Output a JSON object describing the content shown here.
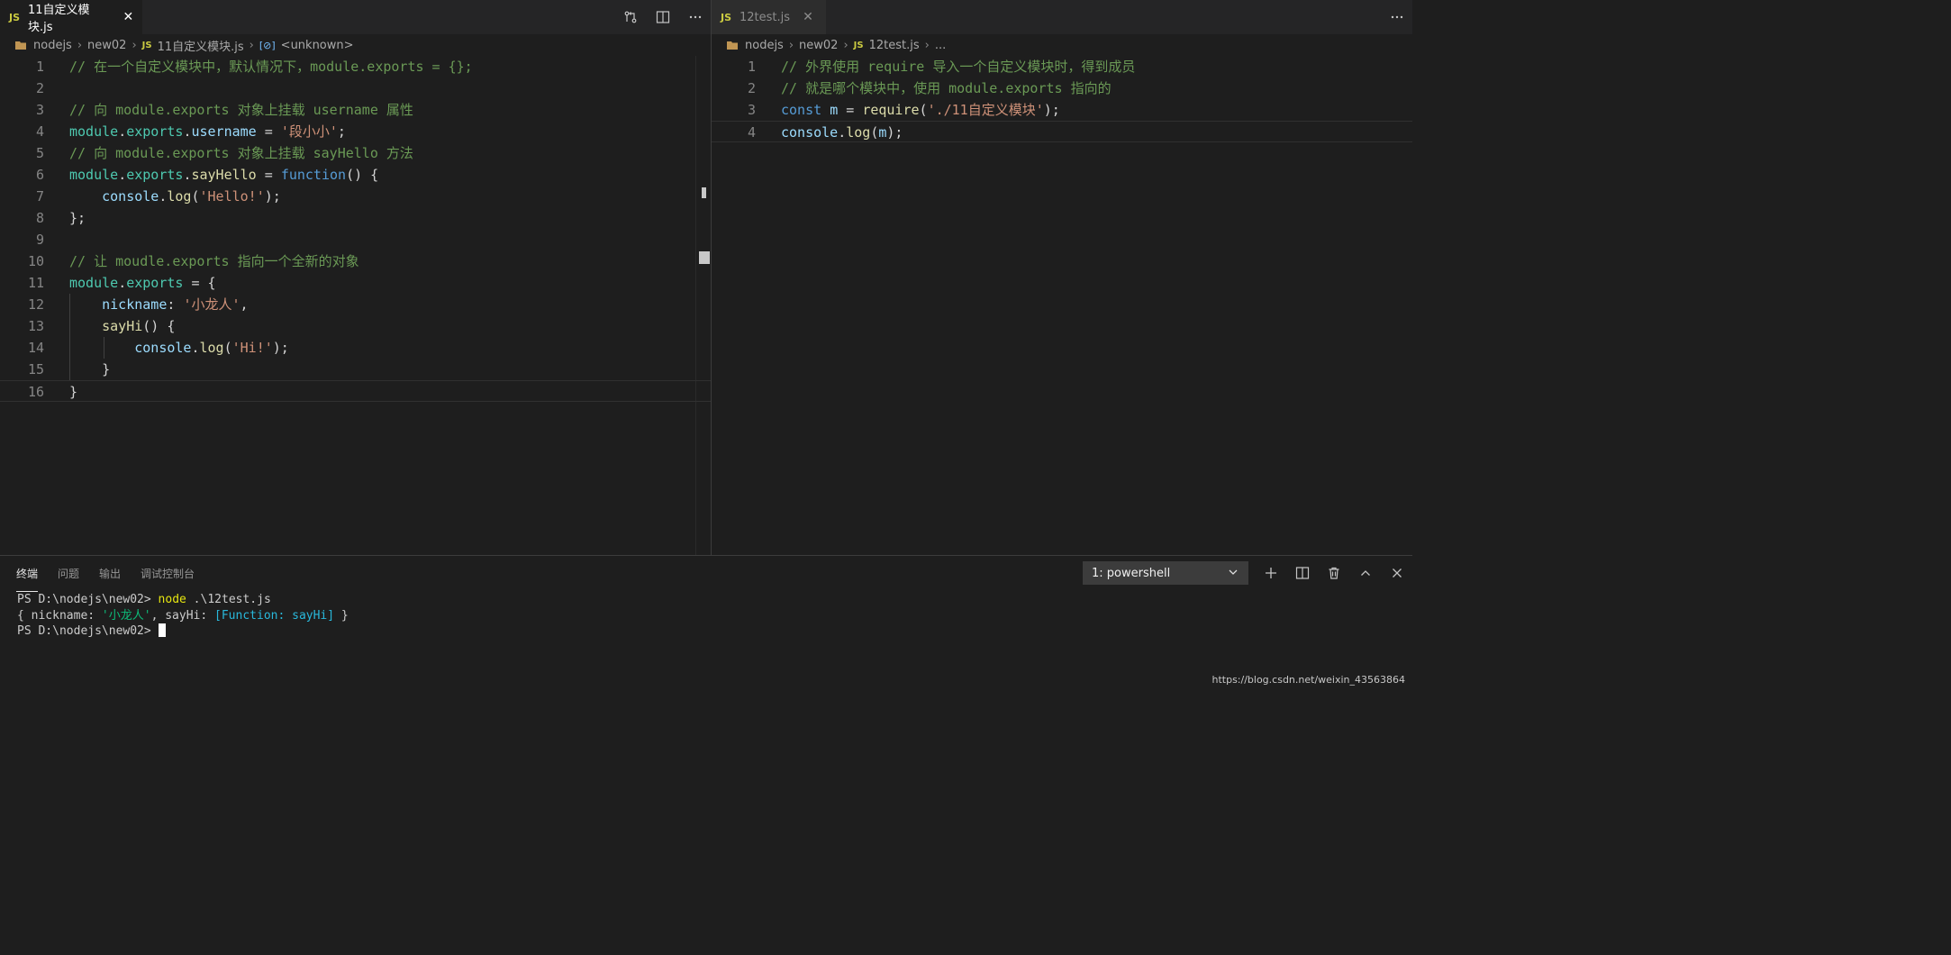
{
  "left_editor": {
    "tab": {
      "badge": "JS",
      "label": "11自定义模块.js",
      "close": "✕"
    },
    "breadcrumb": [
      "nodejs",
      "new02",
      "11自定义模块.js",
      "<unknown>"
    ],
    "breadcrumb_symbol": "[⊘]",
    "lines": [
      {
        "n": "1",
        "tokens": [
          [
            "c-com",
            "// 在一个自定义模块中，默认情况下，module.exports = {};"
          ]
        ]
      },
      {
        "n": "2",
        "tokens": []
      },
      {
        "n": "3",
        "tokens": [
          [
            "c-com",
            "// 向 module.exports 对象上挂载 username 属性"
          ]
        ]
      },
      {
        "n": "4",
        "tokens": [
          [
            "c-var",
            "module"
          ],
          [
            "c-pun",
            "."
          ],
          [
            "c-var",
            "exports"
          ],
          [
            "c-pun",
            "."
          ],
          [
            "c-prop",
            "username"
          ],
          [
            "c-pun",
            " = "
          ],
          [
            "c-str",
            "'段小小'"
          ],
          [
            "c-pun",
            ";"
          ]
        ]
      },
      {
        "n": "5",
        "tokens": [
          [
            "c-com",
            "// 向 module.exports 对象上挂载 sayHello 方法"
          ]
        ]
      },
      {
        "n": "6",
        "tokens": [
          [
            "c-var",
            "module"
          ],
          [
            "c-pun",
            "."
          ],
          [
            "c-var",
            "exports"
          ],
          [
            "c-pun",
            "."
          ],
          [
            "c-fn",
            "sayHello"
          ],
          [
            "c-pun",
            " = "
          ],
          [
            "c-kw",
            "function"
          ],
          [
            "c-pun",
            "() {"
          ]
        ]
      },
      {
        "n": "7",
        "tokens": [
          [
            "c-pun",
            "    "
          ],
          [
            "c-prop",
            "console"
          ],
          [
            "c-pun",
            "."
          ],
          [
            "c-fn",
            "log"
          ],
          [
            "c-pun",
            "("
          ],
          [
            "c-str",
            "'Hello!'"
          ],
          [
            "c-pun",
            ");"
          ]
        ]
      },
      {
        "n": "8",
        "tokens": [
          [
            "c-pun",
            "};"
          ]
        ]
      },
      {
        "n": "9",
        "tokens": []
      },
      {
        "n": "10",
        "tokens": [
          [
            "c-com",
            "// 让 moudle.exports 指向一个全新的对象"
          ]
        ]
      },
      {
        "n": "11",
        "tokens": [
          [
            "c-var",
            "module"
          ],
          [
            "c-pun",
            "."
          ],
          [
            "c-var",
            "exports"
          ],
          [
            "c-pun",
            " = {"
          ]
        ]
      },
      {
        "n": "12",
        "tokens": [
          [
            "c-pun",
            "    "
          ],
          [
            "c-prop",
            "nickname"
          ],
          [
            "c-pun",
            ": "
          ],
          [
            "c-str",
            "'小龙人'"
          ],
          [
            "c-pun",
            ","
          ]
        ]
      },
      {
        "n": "13",
        "tokens": [
          [
            "c-pun",
            "    "
          ],
          [
            "c-fn",
            "sayHi"
          ],
          [
            "c-pun",
            "() {"
          ]
        ]
      },
      {
        "n": "14",
        "tokens": [
          [
            "c-pun",
            "        "
          ],
          [
            "c-prop",
            "console"
          ],
          [
            "c-pun",
            "."
          ],
          [
            "c-fn",
            "log"
          ],
          [
            "c-pun",
            "("
          ],
          [
            "c-str",
            "'Hi!'"
          ],
          [
            "c-pun",
            ");"
          ]
        ]
      },
      {
        "n": "15",
        "tokens": [
          [
            "c-pun",
            "    }"
          ]
        ]
      },
      {
        "n": "16",
        "tokens": [
          [
            "c-pun",
            "}"
          ]
        ]
      }
    ],
    "current_line": 16
  },
  "right_editor": {
    "tab": {
      "badge": "JS",
      "label": "12test.js",
      "close": "✕"
    },
    "breadcrumb": [
      "nodejs",
      "new02",
      "12test.js",
      "..."
    ],
    "lines": [
      {
        "n": "1",
        "tokens": [
          [
            "c-com",
            "// 外界使用 require 导入一个自定义模块时，得到成员"
          ]
        ]
      },
      {
        "n": "2",
        "tokens": [
          [
            "c-com",
            "// 就是哪个模块中，使用 module.exports 指向的"
          ]
        ]
      },
      {
        "n": "3",
        "tokens": [
          [
            "c-kw",
            "const"
          ],
          [
            "c-pun",
            " "
          ],
          [
            "c-prop",
            "m"
          ],
          [
            "c-pun",
            " = "
          ],
          [
            "c-fn",
            "require"
          ],
          [
            "c-pun",
            "("
          ],
          [
            "c-str",
            "'./11自定义模块'"
          ],
          [
            "c-pun",
            ");"
          ]
        ]
      },
      {
        "n": "4",
        "tokens": [
          [
            "c-prop",
            "console"
          ],
          [
            "c-pun",
            "."
          ],
          [
            "c-fn",
            "log"
          ],
          [
            "c-pun",
            "("
          ],
          [
            "c-prop",
            "m"
          ],
          [
            "c-pun",
            ");"
          ]
        ]
      }
    ],
    "current_line": 4
  },
  "panel": {
    "tabs": [
      "终端",
      "问题",
      "输出",
      "调试控制台"
    ],
    "active_tab": 0,
    "terminal_select": "1: powershell",
    "terminal_lines": [
      [
        [
          "",
          "PS D:\\nodejs\\new02> "
        ],
        [
          "t-yel",
          "node"
        ],
        [
          "",
          " .\\12test.js"
        ]
      ],
      [
        [
          "",
          "{ nickname: "
        ],
        [
          "t-grn",
          "'小龙人'"
        ],
        [
          "",
          ", sayHi: "
        ],
        [
          "t-blu",
          "[Function: sayHi]"
        ],
        [
          "",
          " }"
        ]
      ],
      [
        [
          "",
          "PS D:\\nodejs\\new02> "
        ]
      ]
    ]
  },
  "watermark": "https://blog.csdn.net/weixin_43563864",
  "colors": {
    "accent_js": "#cbcb41",
    "comment": "#6a9955",
    "string": "#ce9178",
    "keyword": "#569cd6"
  }
}
